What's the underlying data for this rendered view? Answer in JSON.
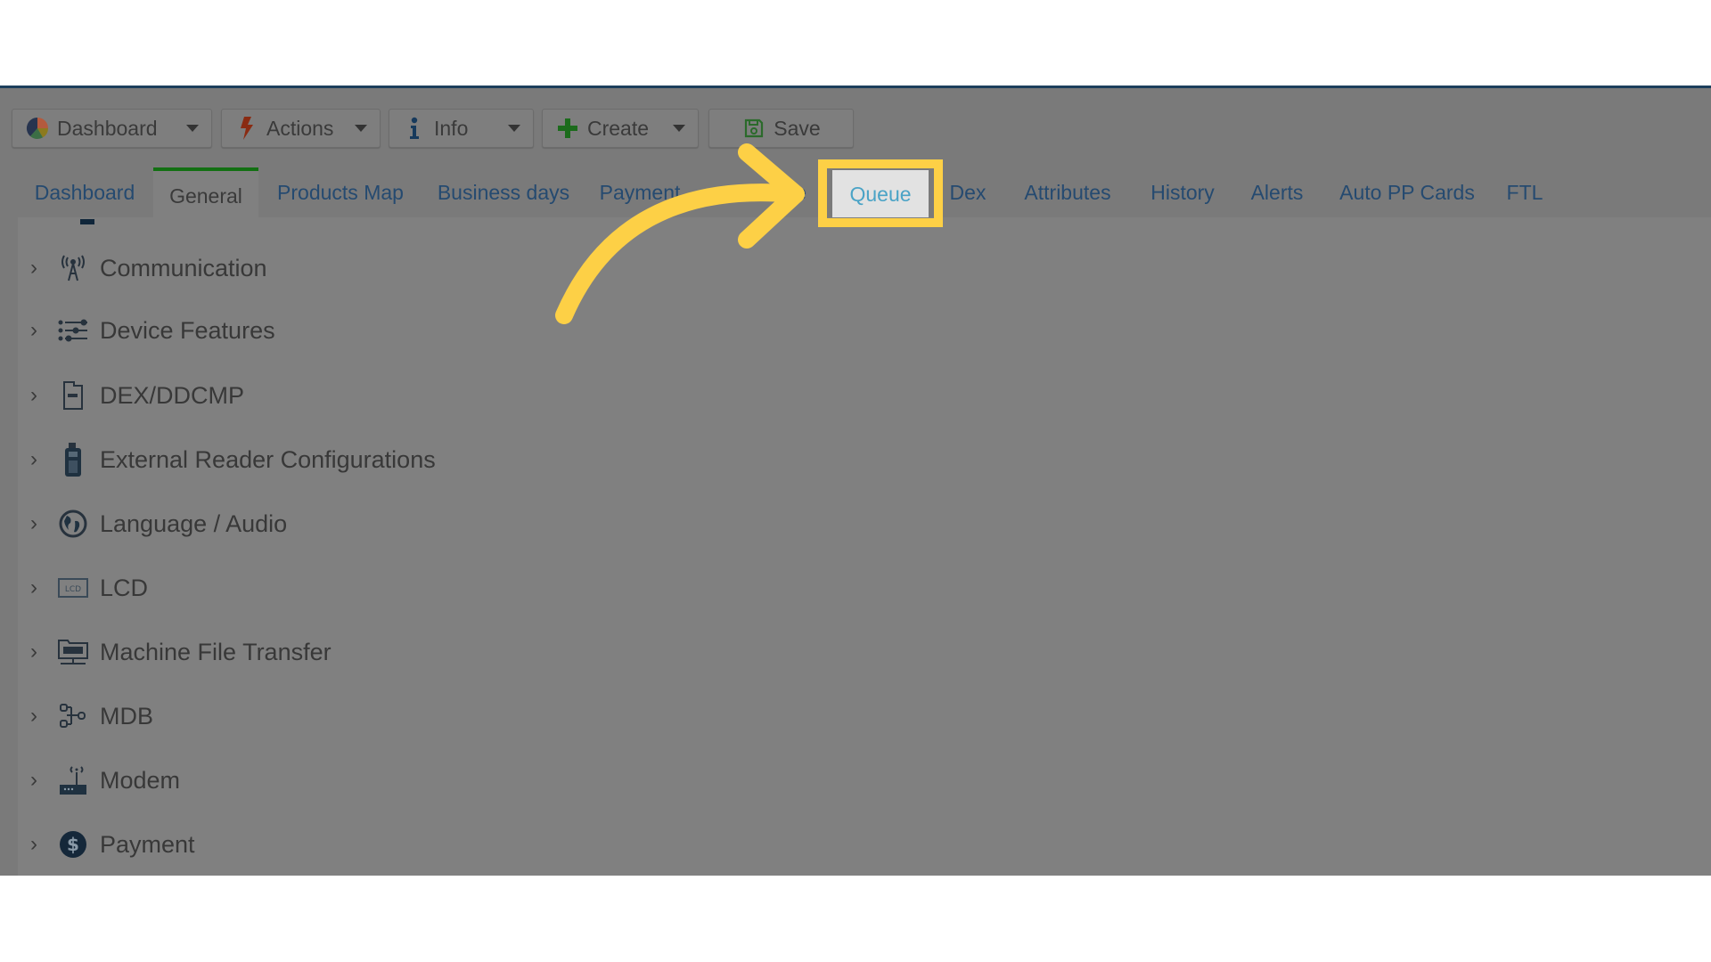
{
  "toolbar": {
    "buttons": [
      {
        "label": "Dashboard",
        "icon": "pie-chart-icon",
        "has_dropdown": true
      },
      {
        "label": "Actions",
        "icon": "lightning-icon",
        "has_dropdown": true
      },
      {
        "label": "Info",
        "icon": "info-icon",
        "has_dropdown": true
      },
      {
        "label": "Create",
        "icon": "plus-icon",
        "has_dropdown": true
      },
      {
        "label": "Save",
        "icon": "save-icon",
        "has_dropdown": false
      }
    ]
  },
  "tabs": [
    {
      "label": "Dashboard"
    },
    {
      "label": "General",
      "active": true
    },
    {
      "label": "Products Map"
    },
    {
      "label": "Business days"
    },
    {
      "label": "Payment"
    },
    {
      "label": "…e",
      "obscured": true
    },
    {
      "label": "Queue",
      "highlighted": true
    },
    {
      "label": "Dex"
    },
    {
      "label": "Attributes"
    },
    {
      "label": "History"
    },
    {
      "label": "Alerts"
    },
    {
      "label": "Auto PP Cards"
    },
    {
      "label": "FTL"
    }
  ],
  "sections": [
    {
      "label": "Communication",
      "icon": "antenna-icon"
    },
    {
      "label": "Device Features",
      "icon": "sliders-icon"
    },
    {
      "label": "DEX/DDCMP",
      "icon": "dex-port-icon"
    },
    {
      "label": "External Reader Configurations",
      "icon": "card-reader-icon"
    },
    {
      "label": "Language / Audio",
      "icon": "globe-icon"
    },
    {
      "label": "LCD",
      "icon": "lcd-icon"
    },
    {
      "label": "Machine File Transfer",
      "icon": "ftp-icon"
    },
    {
      "label": "MDB",
      "icon": "mdb-network-icon"
    },
    {
      "label": "Modem",
      "icon": "modem-icon"
    },
    {
      "label": "Payment",
      "icon": "dollar-coin-icon"
    }
  ],
  "annotation": {
    "target": "Queue",
    "color": "#fdd046"
  },
  "colors": {
    "active_tab_underline": "#137013",
    "tab_link": "#254a70",
    "overlay": "#7a7a7a"
  }
}
